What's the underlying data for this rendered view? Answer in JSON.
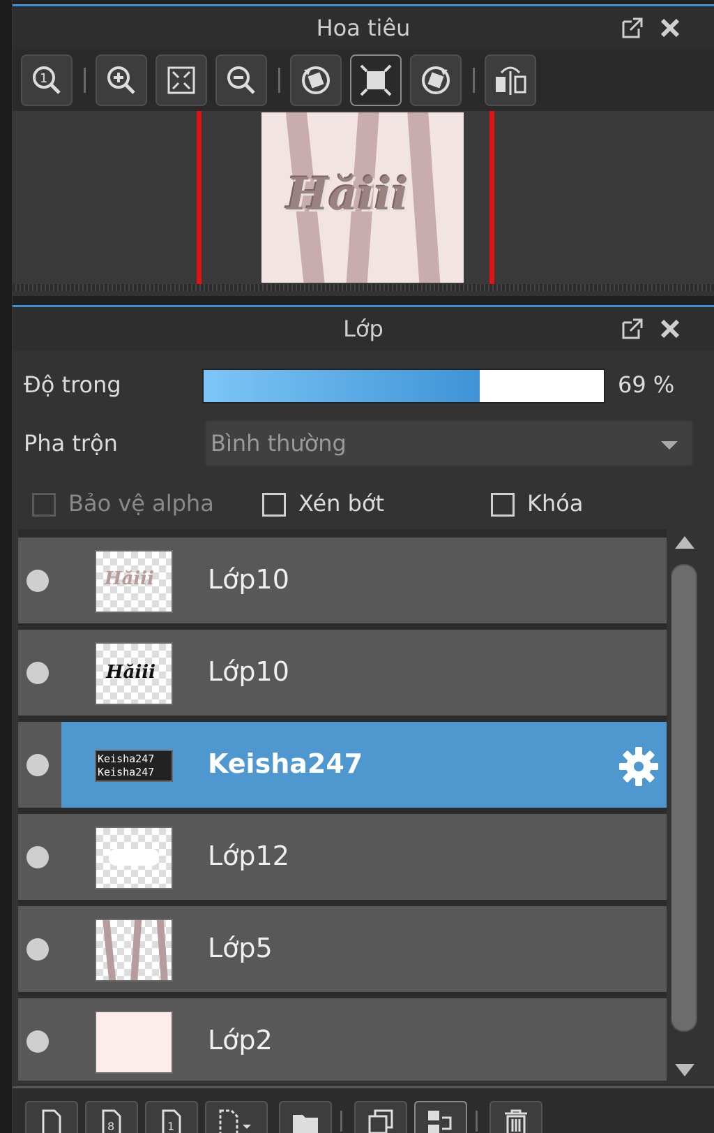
{
  "navigator": {
    "title": "Hoa tiêu",
    "tools": [
      "zoom-actual-icon",
      "zoom-in-icon",
      "fit-window-icon",
      "zoom-out-icon",
      "rotate-left-icon",
      "fit-screen-icon",
      "rotate-right-icon",
      "flip-horizontal-icon"
    ],
    "canvas_art_text": "Hăiii"
  },
  "layer_panel": {
    "title": "Lớp",
    "opacity_label": "Độ trong",
    "opacity_value": 69,
    "opacity_text": "69 %",
    "blend_label": "Pha trộn",
    "blend_value": "Bình thường",
    "protect_alpha_label": "Bảo vệ alpha",
    "clipping_label": "Xén bớt",
    "lock_label": "Khóa",
    "layers": [
      {
        "name": "Lớp10",
        "thumb": "hăiii-pink"
      },
      {
        "name": "Lớp10",
        "thumb": "hăiii-black"
      },
      {
        "name": "Keisha247",
        "thumb": "text-keisha",
        "selected": true
      },
      {
        "name": "Lớp12",
        "thumb": "white-shape"
      },
      {
        "name": "Lớp5",
        "thumb": "stripes"
      },
      {
        "name": "Lớp2",
        "thumb": "pink-fill"
      }
    ]
  },
  "colors": {
    "accent": "#3a8fd6",
    "selected_row": "#4f97cf",
    "marker": "#e01212"
  }
}
